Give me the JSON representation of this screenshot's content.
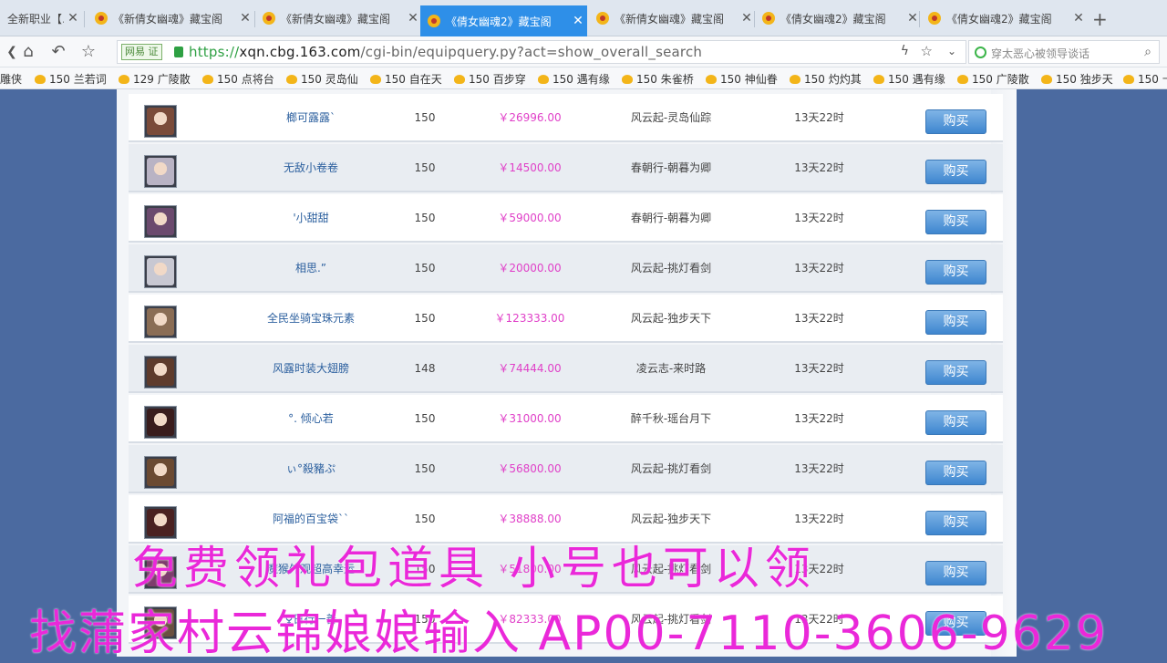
{
  "tabs": [
    {
      "label": "全新职业【…",
      "active": false
    },
    {
      "label": "《新倩女幽魂》藏宝阁",
      "active": false
    },
    {
      "label": "《新倩女幽魂》藏宝阁",
      "active": false
    },
    {
      "label": "《倩女幽魂2》藏宝阁",
      "active": true
    },
    {
      "label": "《新倩女幽魂》藏宝阁",
      "active": false
    },
    {
      "label": "《倩女幽魂2》藏宝阁",
      "active": false
    },
    {
      "label": "《倩女幽魂2》藏宝阁",
      "active": false
    }
  ],
  "new_tab": "+",
  "address": {
    "badge": "网易 证",
    "protocol": "https://",
    "host": "xqn.cbg.163.com",
    "path": "/cgi-bin/equipquery.py?act=show_overall_search"
  },
  "search": {
    "text": "穿太恶心被领导谈话"
  },
  "bookmarks": [
    "雕侠",
    "150 兰若词",
    "129 广陵散",
    "150 点将台",
    "150 灵岛仙",
    "150 自在天",
    "150 百步穿",
    "150 遇有缘",
    "150 朱雀桥",
    "150 神仙眷",
    "150 灼灼其",
    "150 遇有缘",
    "150 广陵散",
    "150 独步天",
    "150 十"
  ],
  "listings": [
    {
      "name": "榔可露露`",
      "level": "150",
      "price": "￥26996.00",
      "server": "风云起-灵岛仙踪",
      "time": "13天22时",
      "buy": "购买"
    },
    {
      "name": "无敌小卷卷",
      "level": "150",
      "price": "￥14500.00",
      "server": "春朝行-朝暮为卿",
      "time": "13天22时",
      "buy": "购买"
    },
    {
      "name": "'小甜甜",
      "level": "150",
      "price": "￥59000.00",
      "server": "春朝行-朝暮为卿",
      "time": "13天22时",
      "buy": "购买"
    },
    {
      "name": "相思.”",
      "level": "150",
      "price": "￥20000.00",
      "server": "风云起-挑灯看剑",
      "time": "13天22时",
      "buy": "购买"
    },
    {
      "name": "全民坐骑宝珠元素",
      "level": "150",
      "price": "￥123333.00",
      "server": "风云起-独步天下",
      "time": "13天22时",
      "buy": "购买"
    },
    {
      "name": "风露时装大翅膀",
      "level": "148",
      "price": "￥74444.00",
      "server": "凌云志-来时路",
      "time": "13天22时",
      "buy": "购买"
    },
    {
      "name": "°. 倾心若",
      "level": "150",
      "price": "￥31000.00",
      "server": "醉千秋-瑶台月下",
      "time": "13天22时",
      "buy": "购买"
    },
    {
      "name": "ぃ°殺豬ぷ",
      "level": "150",
      "price": "￥56800.00",
      "server": "风云起-挑灯看剑",
      "time": "13天22时",
      "buy": "购买"
    },
    {
      "name": "阿福的百宝袋``",
      "level": "150",
      "price": "￥38888.00",
      "server": "风云起-独步天下",
      "time": "13天22时",
      "buy": "购买"
    },
    {
      "name": "魔猴外观超高幸运",
      "level": "150",
      "price": "￥51800.00",
      "server": "风云起-挑灯看剑",
      "time": "13天22时",
      "buy": "购买"
    },
    {
      "name": "♀日行一善",
      "level": "150",
      "price": "￥82333.00",
      "server": "风云起-挑灯看剑",
      "time": "13天22时",
      "buy": "购买"
    }
  ],
  "overlay": {
    "line1": "免费领礼包道具 小号也可以领",
    "line2": "找蒲家村云锦娘娘输入 AP00-7110-3606-9629"
  }
}
